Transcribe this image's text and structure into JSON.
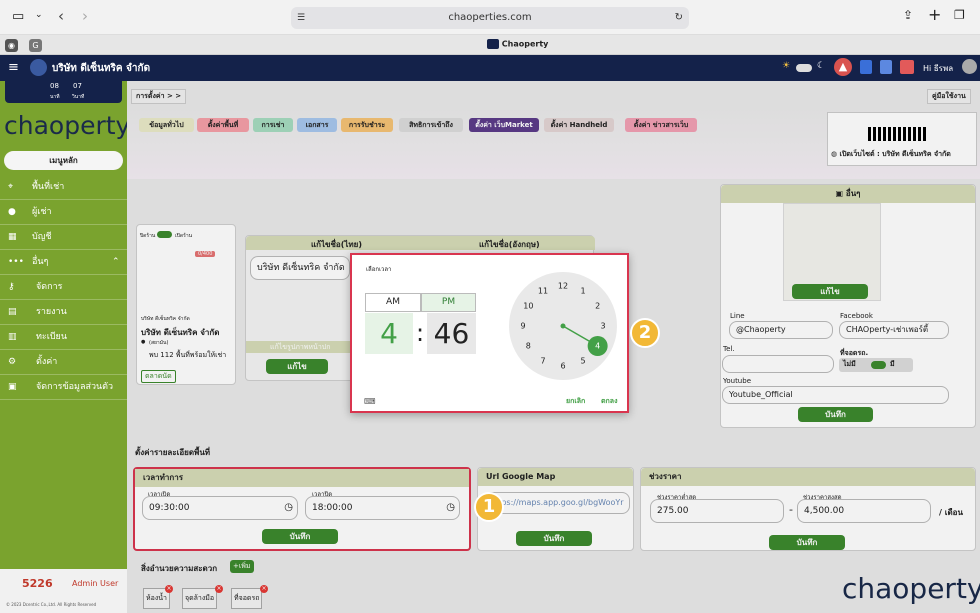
{
  "browser": {
    "url": "chaoperties.com",
    "tab_title": "Chaoperty"
  },
  "header": {
    "company": "บริษัท ดีเซ็นทริค จำกัด",
    "user": "Hi ธีรพล"
  },
  "sidebar": {
    "dates": [
      "08",
      "07"
    ],
    "date_sub": [
      "นาที",
      "วินาที"
    ],
    "logo": "chaoperty",
    "menu_button": "เมนูหลัก",
    "items": [
      {
        "label": "พื้นที่เช่า",
        "icon": "pin-icon"
      },
      {
        "label": "ผู้เช่า",
        "icon": "person-icon"
      },
      {
        "label": "บัญชี",
        "icon": "calendar-icon"
      },
      {
        "label": "อื่นๆ",
        "icon": "dots-icon"
      },
      {
        "label": "จัดการ",
        "icon": "key-icon"
      },
      {
        "label": "รายงาน",
        "icon": "report-icon"
      },
      {
        "label": "ทะเบียน",
        "icon": "register-icon"
      },
      {
        "label": "ตั้งค่า",
        "icon": "gear-icon"
      },
      {
        "label": "จัดการข้อมูลส่วนตัว",
        "icon": "profile-icon"
      }
    ],
    "footer_code": "5226",
    "footer_user": "Admin User",
    "copyright": "© 2023 Dcentric Co.,Ltd. All Rights Reserved"
  },
  "breadcrumb": "การตั้งค่า > >",
  "user_manual": "คู่มือใช้งาน",
  "tabs": [
    "ข้อมูลทั่วไป",
    "ตั้งค่าพื้นที่",
    "การเช่า",
    "เอกสาร",
    "การรับชำระ",
    "สิทธิการเข้าถึง",
    "ตั้งค่า เว็บMarket",
    "ตั้งค่า Handheld",
    "ตั้งค่า ข่าวสารเว็บ"
  ],
  "open_website": "เปิดเว็บไซต์ : บริษัท ดีเซ็นทริค จำกัด",
  "preview": {
    "toggle_left": "ปิดร้าน",
    "toggle_right": "เปิดร้าน",
    "views": "0/400",
    "small_name": "บริษัท ดีเซ็นทริค จำกัด",
    "name": "บริษัท ดีเซ็นทริค จำกัด",
    "location": "(สยามัน)",
    "desc": "พบ 112 พื้นที่พร้อมให้เช่า",
    "button": "ตลาดนัด"
  },
  "name_edit": {
    "thai_label": "แก้ไขชื่อ(ไทย)",
    "eng_label": "แก้ไขชื่อ(อังกฤษ)",
    "thai_value": "บริษัท ดีเซ็นทริค จำกัด",
    "cover_label": "แก้ไขรูปภาพหน้าปก",
    "save": "แก้ไข"
  },
  "others": {
    "title": "อื่นๆ",
    "edit_button": "แก้ไข",
    "line_label": "Line",
    "line_value": "@Chaoperty",
    "facebook_label": "Facebook",
    "facebook_value": "CHAOperty-เช่าเพอร์ตี้",
    "tel_label": "Tel.",
    "parking_label": "ที่จอดรถ.",
    "no_label": "ไม่มี",
    "yes_label": "มี",
    "youtube_label": "Youtube",
    "youtube_value": "Youtube_Official",
    "save": "บันทึก"
  },
  "settings_title": "ตั้งค่ารายละเอียดพื้นที่",
  "business_hours": {
    "title": "เวลาทำการ",
    "open_label": "เวลาเปิด",
    "open_value": "09:30:00",
    "close_label": "เวลาปิด",
    "close_value": "18:00:00",
    "save": "บันทึก"
  },
  "google_map": {
    "title": "Url Google Map",
    "value": "https://maps.app.goo.gl/bgWooYr",
    "save": "บันทึก"
  },
  "price_range": {
    "title": "ช่วงราคา",
    "min_label": "ช่วงราคาต่ำสุด",
    "min_value": "275.00",
    "dash": "-",
    "max_label": "ช่วงราคาสูงสุด",
    "max_value": "4,500.00",
    "unit": "/ เดือน",
    "save": "บันทึก"
  },
  "facilities": {
    "title": "สิ่งอำนวยความสะดวก",
    "add": "+เพิ่ม",
    "items": [
      "ห้องน้ำ",
      "จุดล้างมือ",
      "ที่จอดรถ"
    ]
  },
  "time_picker": {
    "title": "เลือกเวลา",
    "am": "AM",
    "pm": "PM",
    "selected_period": "PM",
    "hour": "4",
    "colon": ":",
    "minute": "46",
    "clock_numbers": [
      "12",
      "1",
      "2",
      "3",
      "4",
      "5",
      "6",
      "7",
      "8",
      "9",
      "10",
      "11"
    ],
    "selected_hour": 4,
    "cancel": "ยกเลิก",
    "ok": "ตกลง"
  },
  "badges": {
    "one": "1",
    "two": "2"
  },
  "watermark": "chaoperty",
  "colors": {
    "primary_green": "#7aa32e",
    "button_green": "#3d8a2e",
    "header_navy": "#14224a",
    "highlight_red": "#d9354f",
    "badge_yellow": "#f2b836",
    "clock_green": "#43a047"
  }
}
